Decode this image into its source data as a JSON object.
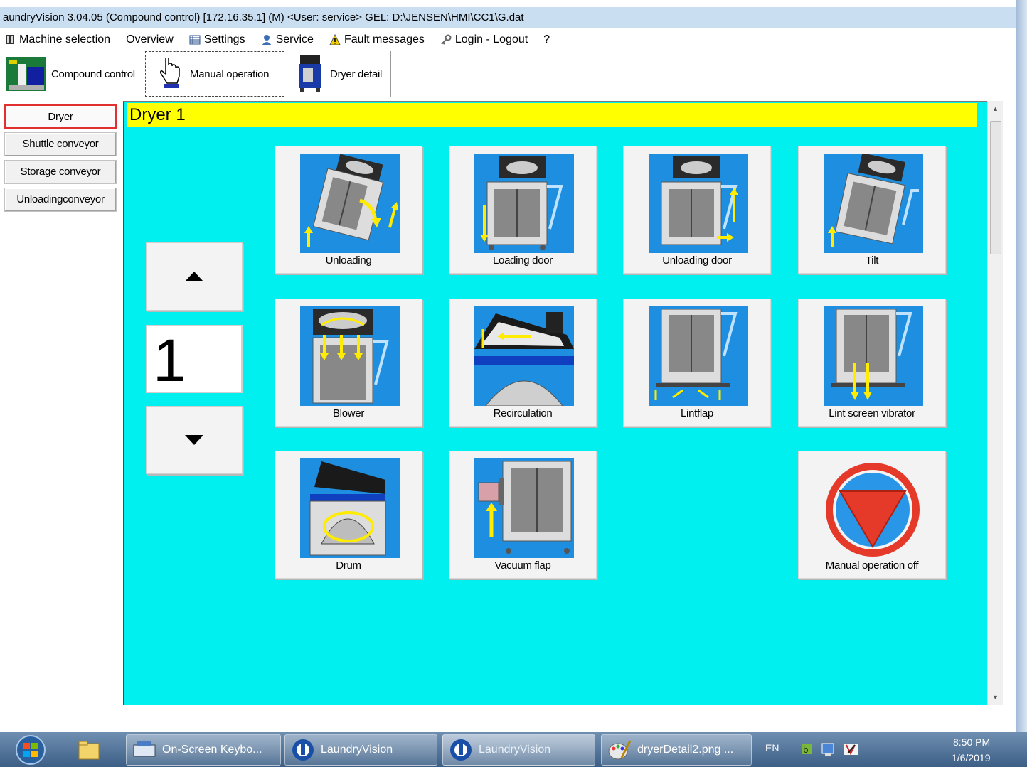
{
  "window": {
    "title": "aundryVision 3.04.05 (Compound control) [172.16.35.1] (M) <User: service>   GEL: D:\\JENSEN\\HMI\\CC1\\G.dat"
  },
  "menu": [
    {
      "label": "Machine selection",
      "icon": "machine-icon"
    },
    {
      "label": "Overview",
      "icon": ""
    },
    {
      "label": "Settings",
      "icon": "settings-table-icon"
    },
    {
      "label": "Service",
      "icon": "service-person-icon"
    },
    {
      "label": "Fault messages",
      "icon": "warning-icon"
    },
    {
      "label": "Login - Logout",
      "icon": "login-key-icon"
    },
    {
      "label": "?",
      "icon": ""
    }
  ],
  "toolbar": {
    "compound": "Compound control",
    "manual": "Manual operation",
    "dryer_detail": "Dryer detail"
  },
  "sidebar": [
    "Dryer",
    "Shuttle conveyor",
    "Storage conveyor",
    "Unloadingconveyor"
  ],
  "panel": {
    "title": "Dryer 1",
    "counter": "1"
  },
  "tiles": [
    {
      "label": "Unloading",
      "icon": "unloading-icon"
    },
    {
      "label": "Loading door",
      "icon": "loading-door-icon"
    },
    {
      "label": "Unloading door",
      "icon": "unloading-door-icon"
    },
    {
      "label": "Tilt",
      "icon": "tilt-icon"
    },
    {
      "label": "Blower",
      "icon": "blower-icon"
    },
    {
      "label": "Recirculation",
      "icon": "recirculation-icon"
    },
    {
      "label": "Lintflap",
      "icon": "lintflap-icon"
    },
    {
      "label": "Lint screen vibrator",
      "icon": "lint-screen-vibrator-icon"
    },
    {
      "label": "Drum",
      "icon": "drum-icon"
    },
    {
      "label": "Vacuum flap",
      "icon": "vacuum-flap-icon"
    },
    {
      "label": "Manual operation off",
      "icon": "manual-off-icon"
    }
  ],
  "taskbar": {
    "items": [
      "On-Screen Keybo...",
      "LaundryVision",
      "LaundryVision",
      "dryerDetail2.png ..."
    ],
    "lang": "EN",
    "time": "8:50 PM",
    "date": "1/6/2019"
  },
  "colors": {
    "panel_bg": "#00f0f0",
    "header_bg": "#ffff00",
    "tile_icon_bg": "#1e8fe0",
    "selected_border": "#e03030"
  }
}
